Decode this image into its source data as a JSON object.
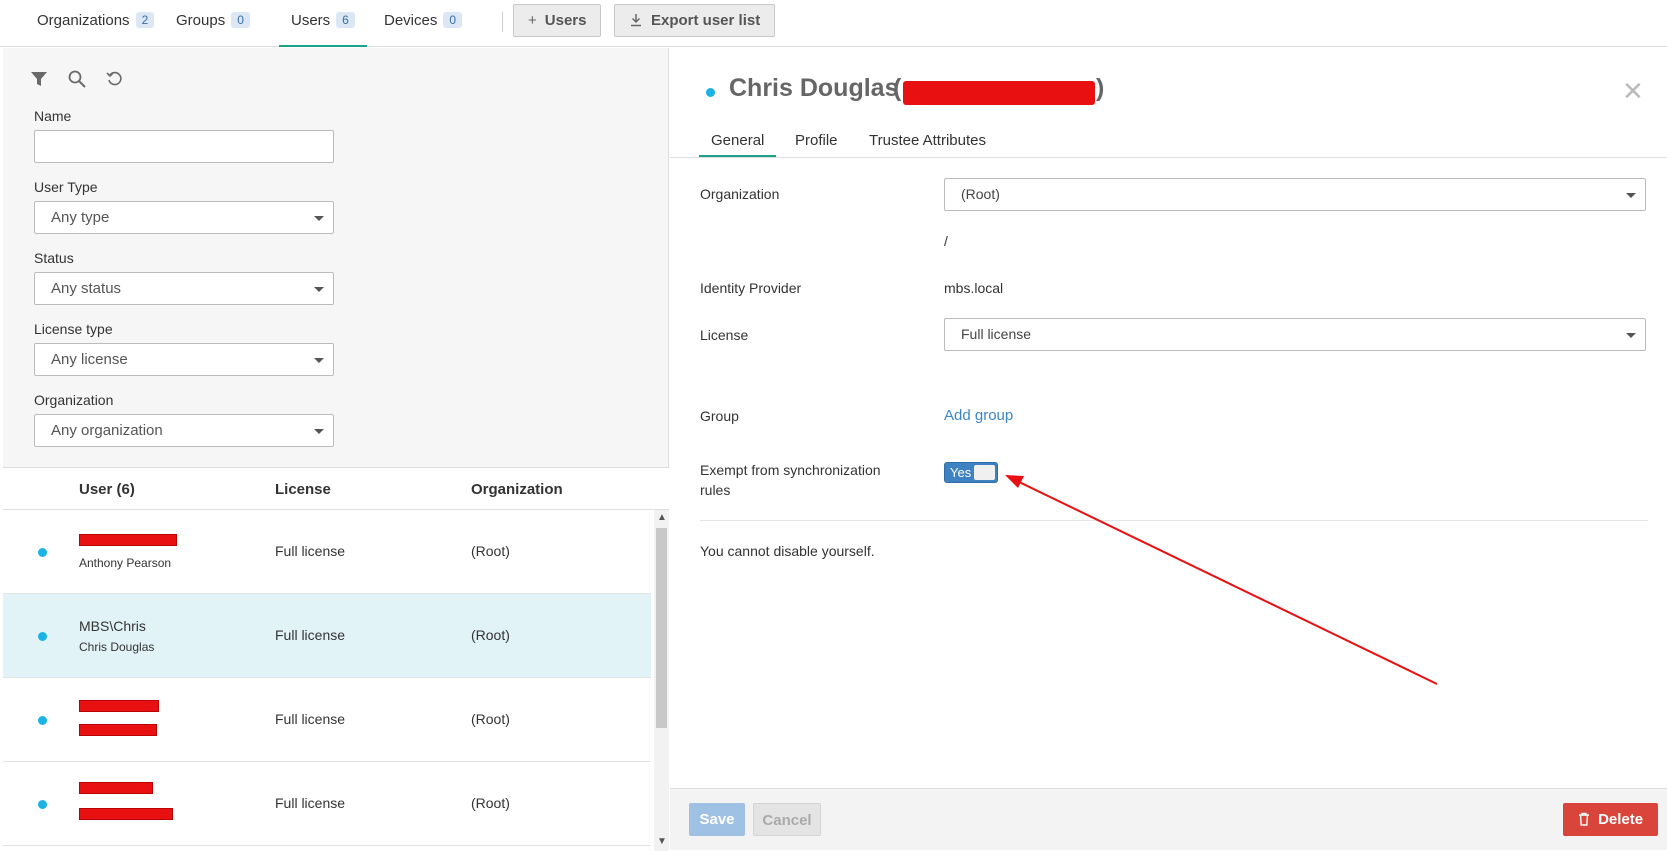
{
  "topnav": {
    "tabs": [
      {
        "label": "Organizations",
        "count": "2"
      },
      {
        "label": "Groups",
        "count": "0"
      },
      {
        "label": "Users",
        "count": "6"
      },
      {
        "label": "Devices",
        "count": "0"
      }
    ],
    "users_button": "Users",
    "export_button": "Export user list"
  },
  "filters": {
    "name_label": "Name",
    "name_value": "",
    "user_type_label": "User Type",
    "user_type_value": "Any type",
    "status_label": "Status",
    "status_value": "Any status",
    "license_label": "License type",
    "license_value": "Any license",
    "org_label": "Organization",
    "org_value": "Any organization"
  },
  "table": {
    "col_user": "User (6)",
    "col_license": "License",
    "col_org": "Organization",
    "rows": [
      {
        "login": "",
        "name": "Anthony Pearson",
        "license": "Full license",
        "org": "(Root)"
      },
      {
        "login": "MBS\\Chris",
        "name": "Chris Douglas",
        "license": "Full license",
        "org": "(Root)"
      },
      {
        "login": "",
        "name": "",
        "license": "Full license",
        "org": "(Root)"
      },
      {
        "login": "",
        "name": "",
        "license": "Full license",
        "org": "(Root)"
      }
    ]
  },
  "detail": {
    "title": "Chris Douglas",
    "tabs": [
      "General",
      "Profile",
      "Trustee Attributes"
    ],
    "organization_label": "Organization",
    "organization_value": "(Root)",
    "org_path": "/",
    "idp_label": "Identity Provider",
    "idp_value": "mbs.local",
    "license_label": "License",
    "license_value": "Full license",
    "group_label": "Group",
    "add_group": "Add group",
    "exempt_label_line1": "Exempt from synchronization",
    "exempt_label_line2": "rules",
    "exempt_toggle": "Yes",
    "note": "You cannot disable yourself."
  },
  "footer": {
    "save": "Save",
    "cancel": "Cancel",
    "delete": "Delete"
  },
  "colors": {
    "accent": "#1aa38a",
    "status_dot": "#1ab3e6",
    "toggle_on": "#3e82c2",
    "delete": "#d9453b",
    "annotation_arrow": "#e81010"
  }
}
